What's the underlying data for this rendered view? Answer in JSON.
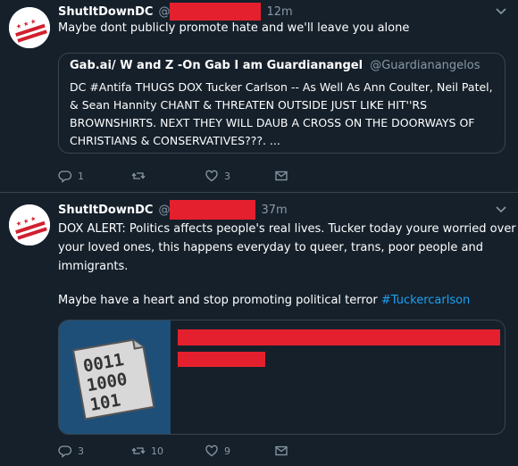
{
  "colors": {
    "background": "#15202b",
    "text": "#ffffff",
    "muted": "#8899a6",
    "border": "#38444d",
    "link": "#1da1f2",
    "redaction": "#e5202e"
  },
  "tweets": [
    {
      "name": "ShutItDownDC",
      "handle": "@",
      "time": "12m",
      "text": "Maybe dont publicly promote hate and we'll leave you alone",
      "quote": {
        "name": "Gab.ai/ W and Z -On Gab I am Guardianangel",
        "handle": "@Guardianangelos",
        "lines": [
          "DC #Antifa THUGS DOX Tucker Carlson -- As Well As Ann Coulter, Neil Patel,",
          "& Sean Hannity CHANT & THREATEN OUTSIDE JUST LIKE HIT''RS",
          "BROWNSHIRTS. NEXT THEY WILL DAUB A CROSS ON THE DOORWAYS OF",
          "CHRISTIANS & CONSERVATIVES???. ..."
        ]
      },
      "actions": {
        "reply_count": "1",
        "retweet_count": "",
        "like_count": "3"
      }
    },
    {
      "name": "ShutItDownDC",
      "handle": "@",
      "time": "37m",
      "lines": [
        "DOX ALERT: Politics affects people's real lives. Tucker today youre worried over",
        "your loved ones, this happens everyday to queer, trans, poor people and",
        "immigrants."
      ],
      "last_line": "Maybe have a heart and stop promoting political terror",
      "hashtag": "#Tuckercarlson",
      "card": {
        "image_digits": [
          "0011",
          "1000",
          "101"
        ]
      },
      "actions": {
        "reply_count": "3",
        "retweet_count": "10",
        "like_count": "9"
      }
    }
  ],
  "icons": [
    "avatar-flag-icon",
    "chevron-down-icon",
    "reply-icon",
    "retweet-icon",
    "like-icon",
    "dm-icon",
    "binary-file-icon"
  ]
}
